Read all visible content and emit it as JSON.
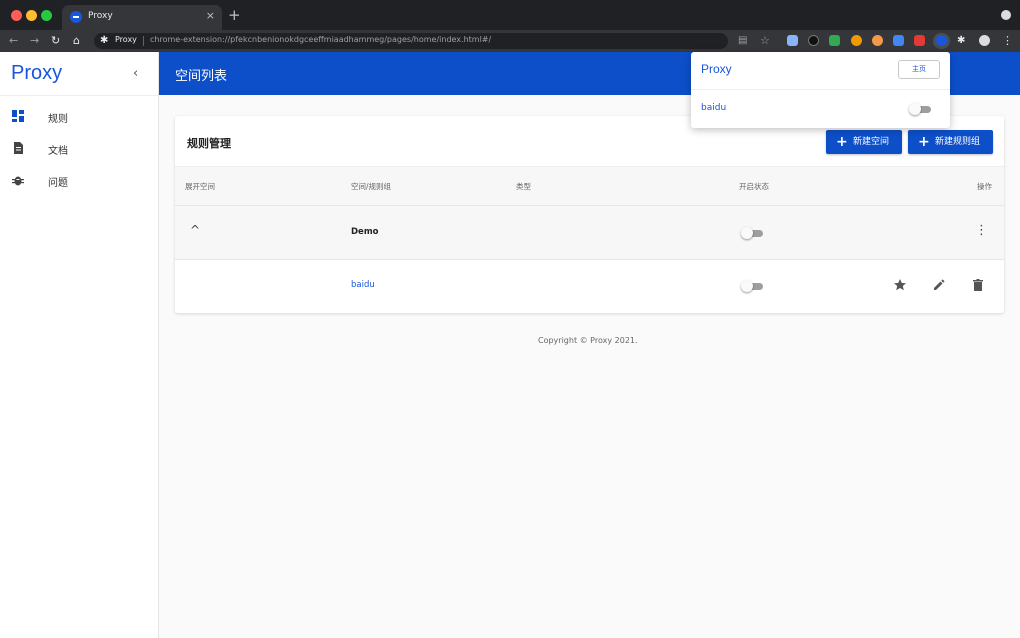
{
  "browser": {
    "tab_title": "Proxy",
    "tab_close": "×",
    "new_tab": "+",
    "omnibox_name": "Proxy",
    "omnibox_url": "chrome-extension://pfekcnbenionokdgceeffmiaadhammeg/pages/home/index.html#/"
  },
  "sidebar": {
    "brand": "Proxy",
    "collapse_icon": "‹",
    "items": [
      {
        "label": "规则",
        "icon": "dashboard-icon"
      },
      {
        "label": "文档",
        "icon": "document-icon"
      },
      {
        "label": "问题",
        "icon": "bug-icon"
      }
    ]
  },
  "appbar": {
    "title": "空间列表"
  },
  "card": {
    "title": "规则管理",
    "buttons": {
      "new_space": "新建空间",
      "new_group": "新建规则组",
      "plus": "+"
    },
    "columns": [
      "展开空间",
      "空间/规则组",
      "类型",
      "开启状态",
      "操作"
    ],
    "rows": [
      {
        "type": "group",
        "expand_icon": "^",
        "name": "Demo",
        "enabled": false,
        "menu_icon": "⋮"
      },
      {
        "type": "rule",
        "name": "baidu",
        "enabled": false
      }
    ]
  },
  "footer": {
    "copyright": "Copyright © Proxy 2021."
  },
  "popup": {
    "title": "Proxy",
    "home_button": "主页",
    "items": [
      {
        "name": "baidu",
        "enabled": false
      }
    ]
  },
  "colors": {
    "primary": "#0d4fc9",
    "link": "#1a56db",
    "toggle_off": "#9e9e9e"
  }
}
